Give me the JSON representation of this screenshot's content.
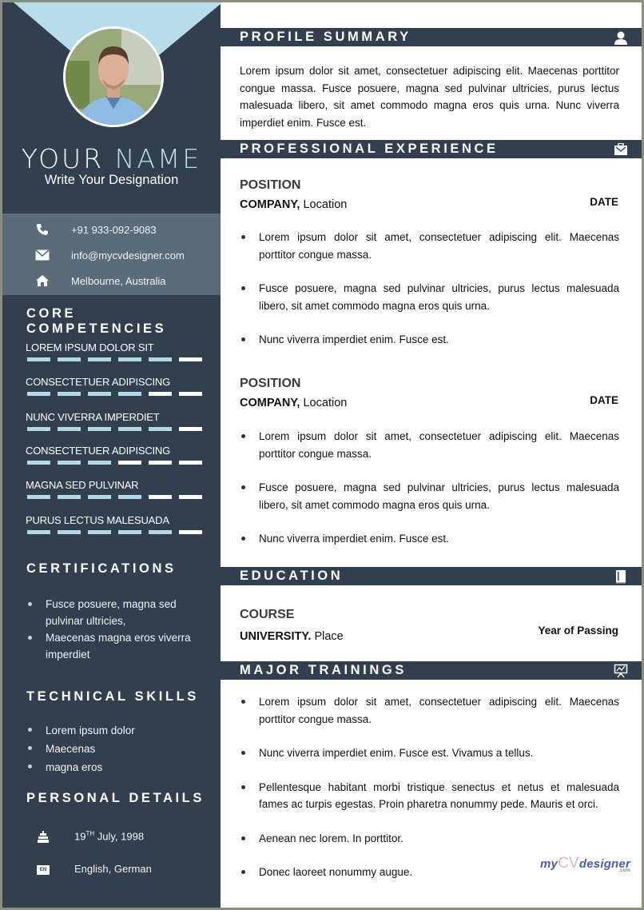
{
  "sidebar": {
    "name_first": "YOUR",
    "name_last": "NAME",
    "designation": "Write Your Designation",
    "contact": [
      {
        "icon": "phone-icon",
        "text": "+91 933-092-9083"
      },
      {
        "icon": "mail-icon",
        "text": "info@mycvdesigner.com"
      },
      {
        "icon": "home-icon",
        "text": "Melbourne, Australia"
      }
    ],
    "core_competencies": {
      "heading": "CORE COMPETENCIES",
      "segments_total": 6,
      "items": [
        {
          "label": "LOREM IPSUM DOLOR SIT",
          "level": 5
        },
        {
          "label": "CONSECTETUER ADIPISCING",
          "level": 4
        },
        {
          "label": "NUNC VIVERRA IMPERDIET",
          "level": 5
        },
        {
          "label": "CONSECTETUER ADIPISCING",
          "level": 3
        },
        {
          "label": "MAGNA SED PULVINAR",
          "level": 4
        },
        {
          "label": "PURUS LECTUS MALESUADA",
          "level": 5
        }
      ]
    },
    "certifications": {
      "heading": "CERTIFICATIONS",
      "items": [
        "Fusce posuere, magna sed pulvinar ultricies,",
        "Maecenas magna eros viverra imperdiet"
      ]
    },
    "technical_skills": {
      "heading": "TECHNICAL SKILLS",
      "items": [
        "Lorem ipsum dolor",
        "Maecenas",
        "magna eros"
      ]
    },
    "personal_details": {
      "heading": "PERSONAL DETAILS",
      "dob_day": "19",
      "dob_suffix": "TH",
      "dob_rest": " July, 1998",
      "languages": "English, German",
      "lang_badge": "EN"
    }
  },
  "main": {
    "profile": {
      "heading": "PROFILE SUMMARY",
      "text": "Lorem ipsum dolor sit amet, consectetuer adipiscing elit. Maecenas porttitor congue massa. Fusce posuere, magna sed pulvinar ultricies, purus lectus malesuada libero, sit amet commodo magna eros quis urna. Nunc viverra imperdiet enim. Fusce est."
    },
    "experience": {
      "heading": "PROFESSIONAL EXPERIENCE",
      "jobs": [
        {
          "position": "POSITION",
          "company": "COMPANY,",
          "location": " Location",
          "date": "DATE",
          "bullets": [
            "Lorem ipsum dolor sit amet, consectetuer adipiscing elit. Maecenas porttitor congue massa.",
            "Fusce posuere, magna sed pulvinar ultricies, purus lectus malesuada libero, sit amet commodo magna eros quis urna.",
            "Nunc viverra imperdiet enim. Fusce est."
          ]
        },
        {
          "position": "POSITION",
          "company": "COMPANY,",
          "location": " Location",
          "date": "DATE",
          "bullets": [
            "Lorem ipsum dolor sit amet, consectetuer adipiscing elit. Maecenas porttitor congue massa.",
            "Fusce posuere, magna sed pulvinar ultricies, purus lectus malesuada libero, sit amet commodo magna eros quis urna.",
            "Nunc viverra imperdiet enim. Fusce est."
          ]
        }
      ]
    },
    "education": {
      "heading": "EDUCATION",
      "course": "COURSE",
      "university": "UNIVERSITY.",
      "place": " Place",
      "year": "Year of Passing"
    },
    "trainings": {
      "heading": "MAJOR TRAININGS",
      "items": [
        "Lorem ipsum dolor sit amet, consectetuer adipiscing elit. Maecenas porttitor congue massa.",
        "Nunc viverra imperdiet enim. Fusce est. Vivamus a tellus.",
        "Pellentesque habitant morbi tristique senectus et netus et malesuada fames ac turpis egestas. Proin pharetra nonummy pede. Mauris et orci.",
        "Aenean nec lorem. In porttitor.",
        "Donec laoreet nonummy augue."
      ]
    },
    "watermark": {
      "part1": "my",
      "part2": "CV",
      "part3": "designer",
      "suffix": ".com"
    }
  },
  "colors": {
    "sidebar": "#323f4f",
    "contact_band": "#5c6b78",
    "accent": "#b3d9e4",
    "triangle": "#b7dcea"
  }
}
